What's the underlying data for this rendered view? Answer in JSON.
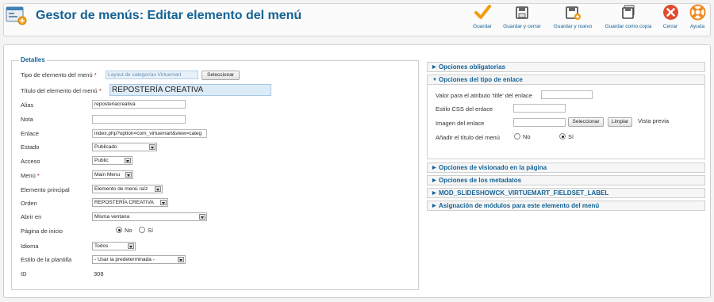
{
  "header": {
    "title": "Gestor de menús: Editar elemento del menú",
    "toolbar": [
      {
        "id": "save",
        "label": "Guardar",
        "icon": "checkmark-icon"
      },
      {
        "id": "save-close",
        "label": "Guardar y cerrar",
        "icon": "save-icon"
      },
      {
        "id": "save-new",
        "label": "Guardar y nuevo",
        "icon": "save-new-icon"
      },
      {
        "id": "save-copy",
        "label": "Guardar como copia",
        "icon": "save-copy-icon"
      },
      {
        "id": "close",
        "label": "Cerrar",
        "icon": "close-icon"
      },
      {
        "id": "help",
        "label": "Ayuda",
        "icon": "help-icon"
      }
    ]
  },
  "details": {
    "legend": "Detalles",
    "type_label": "Tipo de elemento del menú",
    "type_value": "Layout de categorías Virtuemart",
    "select_button": "Seleccionar",
    "title_label": "Título del elemento del menú",
    "title_value": "REPOSTERÍA CREATIVA",
    "alias_label": "Alias",
    "alias_value": "reposteriacreativa",
    "note_label": "Nota",
    "note_value": "",
    "link_label": "Enlace",
    "link_value": "index.php?option=com_virtuemart&view=categ",
    "status_label": "Estado",
    "status_value": "Publicado",
    "access_label": "Acceso",
    "access_value": "Public",
    "menu_label": "Menú",
    "menu_value": "Main Menu",
    "parent_label": "Elemento principal",
    "parent_value": "Elemento de menú raíz",
    "order_label": "Orden",
    "order_value": "REPOSTERÍA CREATIVA",
    "open_label": "Abrir en",
    "open_value": "Misma ventana",
    "home_label": "Página de inicio",
    "home_no": "No",
    "home_yes": "Sí",
    "home_selected": "No",
    "lang_label": "Idioma",
    "lang_value": "Todos",
    "style_label": "Estilo de la plantilla",
    "style_value": "- Usar la predeterminada -",
    "id_label": "ID",
    "id_value": "308",
    "required_mark": "*"
  },
  "panels": {
    "required_options": "Opciones obligatorias",
    "link_type_options": "Opciones del tipo de enlace",
    "display_options": "Opciones de visionado en la página",
    "metadata_options": "Opciones de los metadatos",
    "slideshow": "MOD_SLIDESHOWCK_VIRTUEMART_FIELDSET_LABEL",
    "module_assignment": "Asignación de módulos para este elemento del menú"
  },
  "link_type": {
    "title_attr_label": "Valor para el atributo 'title' del enlace",
    "title_attr_value": "",
    "css_label": "Estilo CSS del enlace",
    "css_value": "",
    "image_label": "Imagen del enlace",
    "image_value": "",
    "image_select": "Seleccionar",
    "image_clear": "Limpiar",
    "preview": "Vista previa",
    "add_title_label": "Añadir el título del menú",
    "add_title_no": "No",
    "add_title_yes": "Sí",
    "add_title_selected": "Sí"
  },
  "colors": {
    "title_blue": "#146295",
    "save_orange": "#f39c12",
    "close_red": "#e04a2f",
    "help_orange": "#f08a24"
  }
}
